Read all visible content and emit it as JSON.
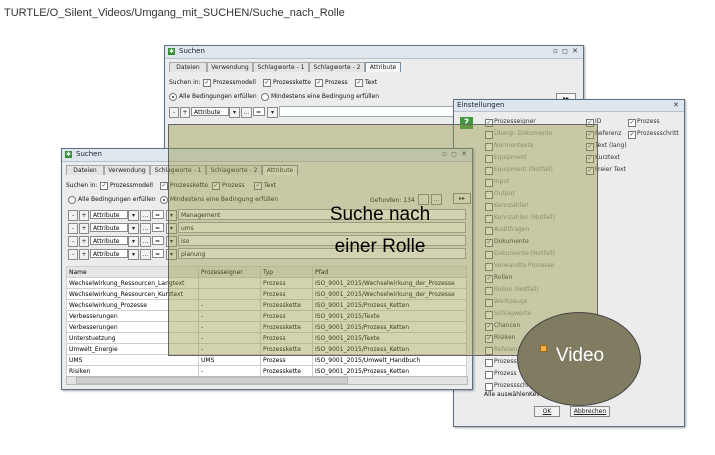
{
  "path": "TURTLE/O_Silent_Videos/Umgang_mit_SUCHEN/Suche_nach_Rolle",
  "back_window": {
    "title": "Suchen",
    "tabs": [
      "Dateien",
      "Verwendung",
      "Schlagworte - 1",
      "Schlagworte - 2",
      "Attribute"
    ],
    "search_in_label": "Suchen in:",
    "checks": [
      "Prozessmodell",
      "Prozesskette",
      "Prozess",
      "Text"
    ],
    "radio_all": "Alle Bedingungen erfüllen",
    "radio_any": "Mindestens eine Bedingung erfüllen",
    "row_attr": "Attribute",
    "row_op": "="
  },
  "front_window": {
    "title": "Suchen",
    "tabs": [
      "Dateien",
      "Verwendung",
      "Schlagworte - 1",
      "Schlagworte - 2",
      "Attribute"
    ],
    "search_in_label": "Suchen in:",
    "checks": [
      "Prozessmodell",
      "Prozesskette",
      "Prozess",
      "Text"
    ],
    "radio_all": "Alle Bedingungen erfüllen",
    "radio_any": "Mindestens eine Bedingung erfüllen",
    "found": "Gefunden: 134",
    "conditions": [
      {
        "attr": "Attribute",
        "op": "=",
        "value": "Management"
      },
      {
        "attr": "Attribute",
        "op": "=",
        "value": "ums"
      },
      {
        "attr": "Attribute",
        "op": "=",
        "value": "iso"
      },
      {
        "attr": "Attribute",
        "op": "=",
        "value": "planung"
      }
    ],
    "columns": [
      "Name",
      "Prozesseigner",
      "Typ",
      "Pfad"
    ],
    "rows": [
      [
        "Wechselwirkung_Ressourcen_Langtext",
        "",
        "Prozess",
        "ISO_9001_2015/Wechselwirkung_der_Prozesse"
      ],
      [
        "Wechselwirkung_Ressourcen_Kurztext",
        "",
        "Prozess",
        "ISO_9001_2015/Wechselwirkung_der_Prozesse"
      ],
      [
        "Wechselwirkung_Prozesse",
        "-",
        "Prozesskette",
        "ISO_9001_2015/Prozess_Ketten"
      ],
      [
        "Verbesserungen",
        "-",
        "Prozess",
        "ISO_9001_2015/Texte"
      ],
      [
        "Verbesserungen",
        "-",
        "Prozesskette",
        "ISO_9001_2015/Prozess_Ketten"
      ],
      [
        "Unterstuetzung",
        "-",
        "Prozess",
        "ISO_9001_2015/Texte"
      ],
      [
        "Umwelt_Energie",
        "-",
        "Prozesskette",
        "ISO_9001_2015/Prozess_Ketten"
      ],
      [
        "UMS",
        "UMS",
        "Prozess",
        "ISO_9001_2015/Umwelt_Handbuch"
      ],
      [
        "Risiken",
        "-",
        "Prozesskette",
        "ISO_9001_2015/Prozess_Ketten"
      ]
    ]
  },
  "overlay_text": [
    "Suche nach",
    "einer Rolle"
  ],
  "settings": {
    "title": "Einstellungen",
    "help": "?",
    "col1": [
      {
        "label": "Prozesseigner",
        "checked": true
      },
      {
        "label": "Übergr. Dokumente",
        "checked": false
      },
      {
        "label": "Normentexte",
        "checked": false
      },
      {
        "label": "Equipment",
        "checked": false
      },
      {
        "label": "Equipment (Notfall)",
        "checked": false
      },
      {
        "label": "Input",
        "checked": false
      },
      {
        "label": "Output",
        "checked": false
      },
      {
        "label": "Kennzahlen",
        "checked": false
      },
      {
        "label": "Kennzahlen (Notfall)",
        "checked": false
      },
      {
        "label": "Auditfragen",
        "checked": false
      },
      {
        "label": "Dokumente",
        "checked": true
      },
      {
        "label": "Dokumente (Notfall)",
        "checked": false
      },
      {
        "label": "Verwandte Prozesse",
        "checked": false
      },
      {
        "label": "Rollen",
        "checked": true
      },
      {
        "label": "Rollen (Notfall)",
        "checked": false
      },
      {
        "label": "Werkzeuge",
        "checked": false
      },
      {
        "label": "Schlagworte",
        "checked": false
      },
      {
        "label": "Chancen",
        "checked": true
      },
      {
        "label": "Risiken",
        "checked": true
      },
      {
        "label": "Referenz",
        "checked": false
      },
      {
        "label": "Prozess",
        "checked": false
      },
      {
        "label": "Prozess",
        "checked": false
      },
      {
        "label": "Prozessschritt",
        "checked": false
      }
    ],
    "col2": [
      {
        "label": "ID",
        "checked": true
      },
      {
        "label": "Referenz",
        "checked": true
      },
      {
        "label": "Text (lang)",
        "checked": true
      },
      {
        "label": "Kurztext",
        "checked": true
      },
      {
        "label": "Freier Text",
        "checked": true
      }
    ],
    "col3": [
      {
        "label": "Prozess",
        "checked": true
      },
      {
        "label": "Prozessschritt",
        "checked": true
      }
    ],
    "select_all": "Alle auswählen",
    "select_none": "Keine",
    "ok": "OK",
    "cancel": "Abbrechen"
  },
  "video_label": "Video"
}
